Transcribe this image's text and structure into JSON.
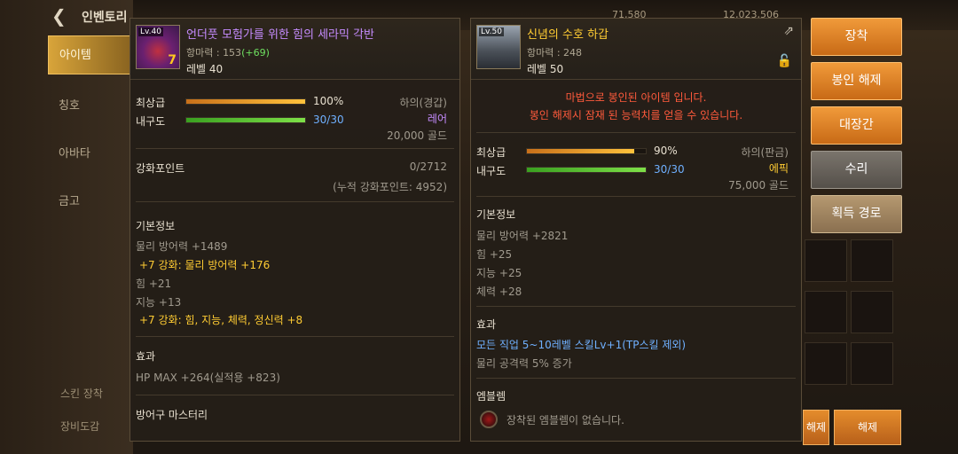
{
  "topbar": {
    "title": "인벤토리",
    "currency_1": "71,580",
    "currency_2": "12,023,506"
  },
  "sidebar": {
    "tabs": [
      {
        "label": "아이템"
      },
      {
        "label": "칭호"
      },
      {
        "label": "아바타"
      },
      {
        "label": "금고"
      }
    ],
    "bottom_1": "스킨 장착",
    "bottom_2": "장비도감"
  },
  "left_item": {
    "level_badge": "Lv.40",
    "plus": "7",
    "name": "언더풋 모험가를 위한 힘의 세라믹 각반",
    "stat_label": "항마력 : ",
    "stat_value": "153",
    "stat_bonus": "(+69)",
    "level": "레벨 40",
    "grade_label": "최상급",
    "grade_value": "100%",
    "grade_pct": 100,
    "durability_label": "내구도",
    "durability_value": "30/30",
    "durability_pct": 100,
    "slot_type": "하의(경갑)",
    "rarity": "레어",
    "price": "20,000 골드",
    "enhance_label": "강화포인트",
    "enhance_value": "0/2712",
    "enhance_total": "(누적 강화포인트: 4952)",
    "basic_title": "기본정보",
    "basic_lines": [
      {
        "text": "물리 방어력 +1489",
        "style": "gray"
      },
      {
        "text": "+7 강화: 물리 방어력 +176",
        "style": "gold"
      },
      {
        "text": "힘 +21",
        "style": "gray"
      },
      {
        "text": "지능 +13",
        "style": "gray"
      },
      {
        "text": "+7 강화: 힘, 지능, 체력, 정신력 +8",
        "style": "gold"
      }
    ],
    "effect_title": "효과",
    "effect_lines": [
      "HP MAX +264(실적용 +823)"
    ],
    "mastery_title": "방어구 마스터리"
  },
  "right_item": {
    "level_badge": "Lv.50",
    "name": "신념의 수호 하갑",
    "stat_line": "항마력 : 248",
    "level": "레벨 50",
    "sealed_line_1": "마법으로 봉인된 아이템 입니다.",
    "sealed_line_2": "봉인 해제시 잠재 된 능력치를 얻을 수 있습니다.",
    "grade_label": "최상급",
    "grade_value": "90%",
    "grade_pct": 90,
    "durability_label": "내구도",
    "durability_value": "30/30",
    "durability_pct": 100,
    "slot_type": "하의(판금)",
    "rarity": "에픽",
    "price": "75,000 골드",
    "basic_title": "기본정보",
    "basic_lines": [
      "물리 방어력 +2821",
      "힘 +25",
      "지능 +25",
      "체력 +28"
    ],
    "effect_title": "효과",
    "effect_line_1": "모든 직업 5~10레벨 스킬Lv+1(TP스킬 제외)",
    "effect_line_2": "물리 공격력 5% 증가",
    "emblem_title": "엠블렘",
    "emblem_text": "장착된 엠블렘이 없습니다."
  },
  "buttons": {
    "equip": "장착",
    "unseal": "봉인 해제",
    "blacksmith": "대장간",
    "repair": "수리",
    "acquire": "획득 경로"
  },
  "bottom_buttons": {
    "left": "해제",
    "right": "해제"
  }
}
